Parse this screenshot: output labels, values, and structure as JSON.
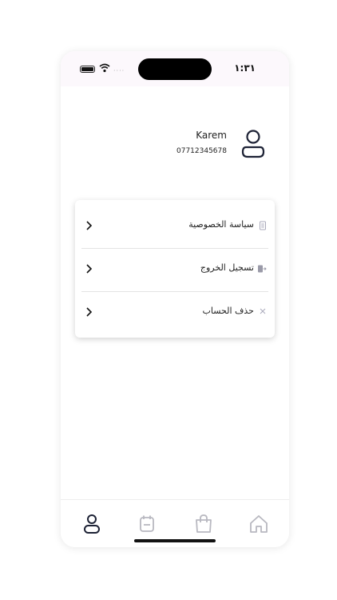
{
  "status_bar": {
    "time": "١:٣١",
    "signal_dots": "····"
  },
  "profile": {
    "name": "Karem",
    "phone": "07712345678",
    "avatar_icon": "user-icon"
  },
  "menu": {
    "items": [
      {
        "label": "سياسة الخصوصية",
        "icon": "document-icon"
      },
      {
        "label": "تسجيل الخروج",
        "icon": "logout-icon"
      },
      {
        "label": "حذف الحساب",
        "icon": "close-icon"
      }
    ]
  },
  "tab_bar": {
    "tabs": [
      {
        "icon": "user-icon",
        "active": true
      },
      {
        "icon": "calendar-icon",
        "active": false
      },
      {
        "icon": "shopping-bag-icon",
        "active": false
      },
      {
        "icon": "home-icon",
        "active": false
      }
    ]
  },
  "colors": {
    "active_icon": "#1d2235",
    "inactive_icon": "#b8b8c0",
    "status_bar_bg": "#fcf8fc"
  }
}
